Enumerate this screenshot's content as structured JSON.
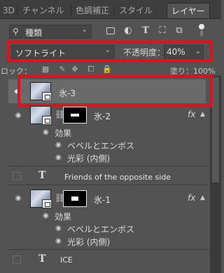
{
  "tabs": [
    "3D",
    "チャンネル",
    "色調補正",
    "スタイル",
    "レイヤー"
  ],
  "filter": {
    "kind_label": "種類"
  },
  "blend": {
    "mode": "ソフトライト",
    "opacity_label": "不透明度：",
    "opacity_value": "40%"
  },
  "lock": {
    "label": "ロック：",
    "fill_label": "塗り：100%"
  },
  "layers": {
    "hyo3": {
      "name": "氷-3"
    },
    "hyo2": {
      "name": "氷-2",
      "fx": "fx",
      "effects_label": "効果",
      "effects": [
        "ベベルとエンボス",
        "光彩 (内側)"
      ]
    },
    "text1": {
      "name": "Friends of the opposite side"
    },
    "hyo1": {
      "name": "氷-1",
      "fx": "fx",
      "effects_label": "効果",
      "effects": [
        "ベベルとエンボス",
        "光彩 (内側)"
      ]
    },
    "text2": {
      "name": "ICE"
    }
  },
  "colors": {
    "highlight": "#e0101d",
    "panel": "#535353"
  }
}
